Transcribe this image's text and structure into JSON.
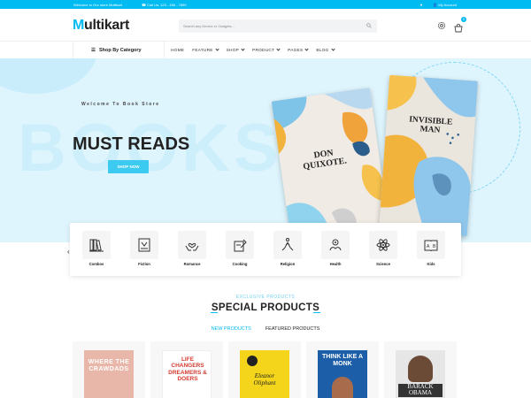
{
  "topbar": {
    "welcome": "Welcome to Our store Multikart",
    "phone": "Call Us: 123 - 456 - 7890",
    "account": "My Account"
  },
  "header": {
    "logo_first": "M",
    "logo_rest": "ultikart",
    "search_placeholder": "Search any Device or Gadgets...",
    "cart_count": "0"
  },
  "nav": {
    "category_button": "Shop By Category",
    "links": [
      "HOME",
      "FEATURE",
      "SHOP",
      "PRODUCT",
      "PAGES",
      "BLOG"
    ]
  },
  "hero": {
    "background_word": "BOOKS",
    "welcome": "Welcome To Book Store",
    "headline": "MUST READS",
    "cta": "SHOP NOW",
    "book1_title": "DON QUIXOTE.",
    "book2_title": "INVISIBLE MAN"
  },
  "categories": [
    "Combos",
    "Fiction",
    "Romance",
    "Cooking",
    "Religion",
    "Health",
    "Science",
    "Kids"
  ],
  "category_icons": [
    "books-icon",
    "open-book-icon",
    "heart-hands-icon",
    "cookbook-icon",
    "prayer-icon",
    "health-icon",
    "atom-icon",
    "abc-book-icon"
  ],
  "products_section": {
    "eyebrow": "EXCLUSIVE PRODUCTS",
    "title": "SPECIAL PRODUCTS",
    "tabs": [
      "NEW PRODUCTS",
      "FEATURED PRODUCTS"
    ]
  },
  "products": [
    {
      "cover_text": "WHERE THE CRAWDADS",
      "color": "#e9b7a9"
    },
    {
      "cover_text": "LIFE CHANGERS DREAMERS & DOERS",
      "color": "#ffffff"
    },
    {
      "cover_text": "Eleanor Oliphant",
      "color": "#f4d51b"
    },
    {
      "cover_text": "THINK LIKE A MONK",
      "color": "#1c5ea8"
    },
    {
      "cover_text": "BARACK OBAMA",
      "color": "#e6e6e6"
    }
  ],
  "colors": {
    "accent": "#00baf2",
    "hero_bg": "#dff5fd"
  }
}
